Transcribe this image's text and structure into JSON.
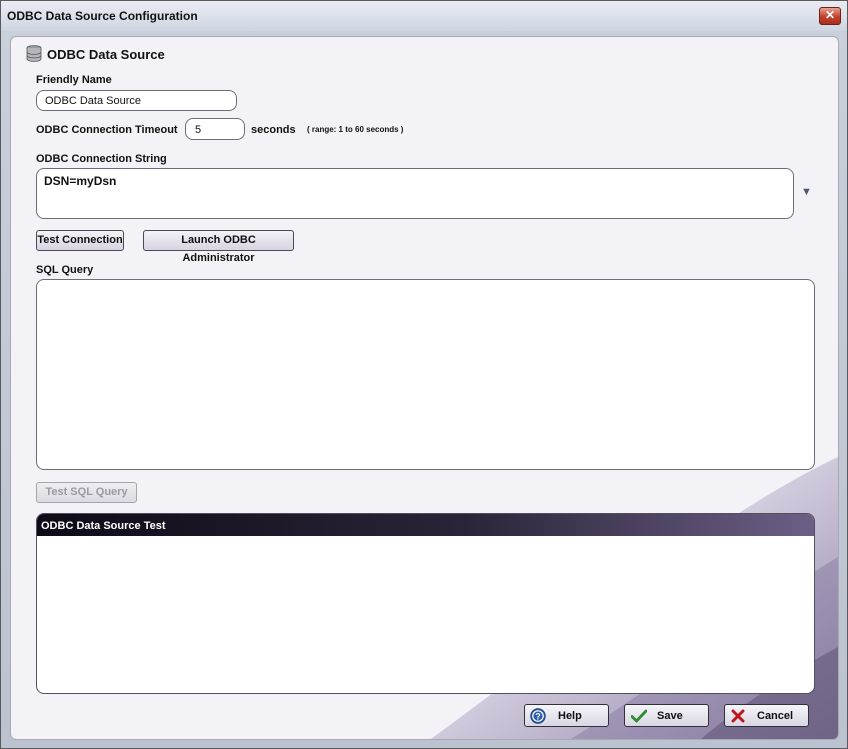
{
  "window": {
    "title": "ODBC Data Source Configuration",
    "close_glyph": "✕"
  },
  "header": {
    "icon": "database-icon",
    "title": "ODBC Data Source"
  },
  "friendly_name": {
    "label": "Friendly Name",
    "value": "ODBC Data Source"
  },
  "timeout": {
    "label": "ODBC Connection Timeout",
    "value": "5",
    "unit": "seconds",
    "range_note": "( range: 1 to 60 seconds )"
  },
  "connection_string": {
    "label": "ODBC Connection String",
    "value": "DSN=myDsn",
    "dropdown_glyph": "▼"
  },
  "buttons": {
    "test_connection": "Test Connection",
    "launch_admin": "Launch ODBC Administrator",
    "test_sql": "Test SQL Query"
  },
  "sql_query": {
    "label": "SQL Query",
    "value": ""
  },
  "test_panel": {
    "title": "ODBC Data Source Test",
    "content": ""
  },
  "footer": {
    "help": "Help",
    "save": "Save",
    "cancel": "Cancel"
  },
  "colors": {
    "accent_dark": "#1a1624",
    "accent_purple": "#6c5f86",
    "save_green": "#2e8b2e",
    "cancel_red": "#c0141b",
    "help_blue": "#2d5fa8"
  }
}
